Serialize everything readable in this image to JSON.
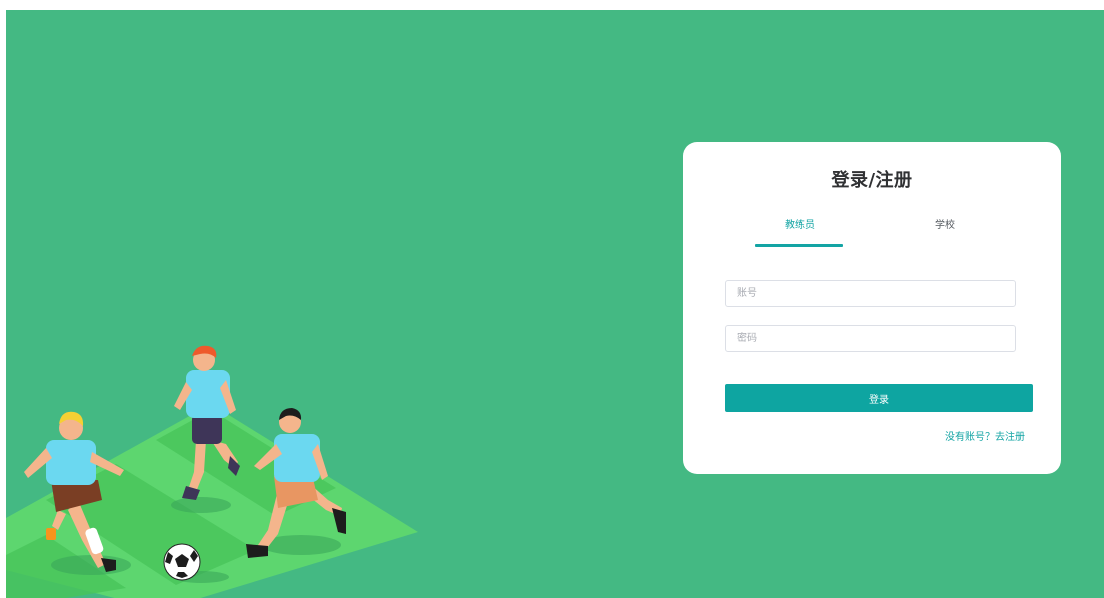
{
  "login_card": {
    "title": "登录/注册",
    "tabs": [
      {
        "label": "教练员",
        "active": true
      },
      {
        "label": "学校",
        "active": false
      }
    ],
    "account_placeholder": "账号",
    "password_placeholder": "密码",
    "login_button": "登录",
    "register_link": "没有账号？去注册"
  },
  "colors": {
    "background": "#44b983",
    "accent": "#13a4a4",
    "button": "#0ea5a1",
    "card": "#ffffff"
  },
  "illustration": {
    "icon": "soccer-players-illustration"
  }
}
